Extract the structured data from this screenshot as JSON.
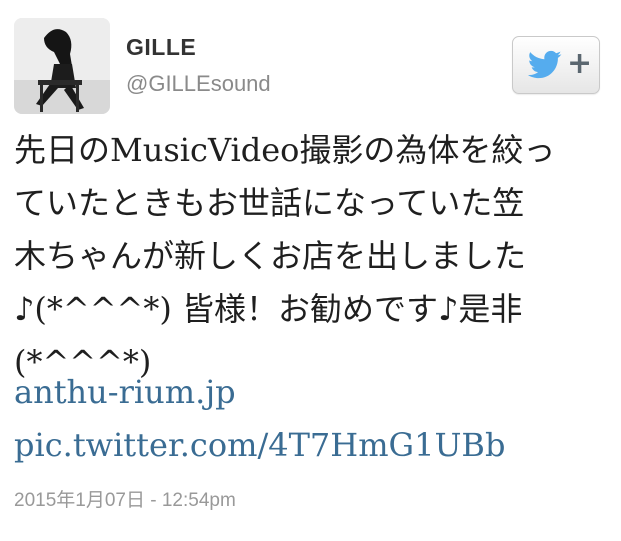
{
  "user": {
    "display_name": "GILLE",
    "handle": "@GILLEsound"
  },
  "follow_button": {
    "icon": "twitter-bird-icon",
    "plus_label": "+",
    "accent": "#55acee"
  },
  "tweet": {
    "text": "先日のMusicVideo撮影の為体を絞っ\nていたときもお世話になっていた笠\n木ちゃんが新しくお店を出しました\n♪(*^^^*) 皆様！お勧めです♪是非\n(*^^^*)",
    "links": [
      "anthu-rium.jp",
      "pic.twitter.com/4T7HmG1UBb"
    ],
    "link_color": "#3a6c93",
    "timestamp": "2015年1月07日 - 12:54pm"
  }
}
